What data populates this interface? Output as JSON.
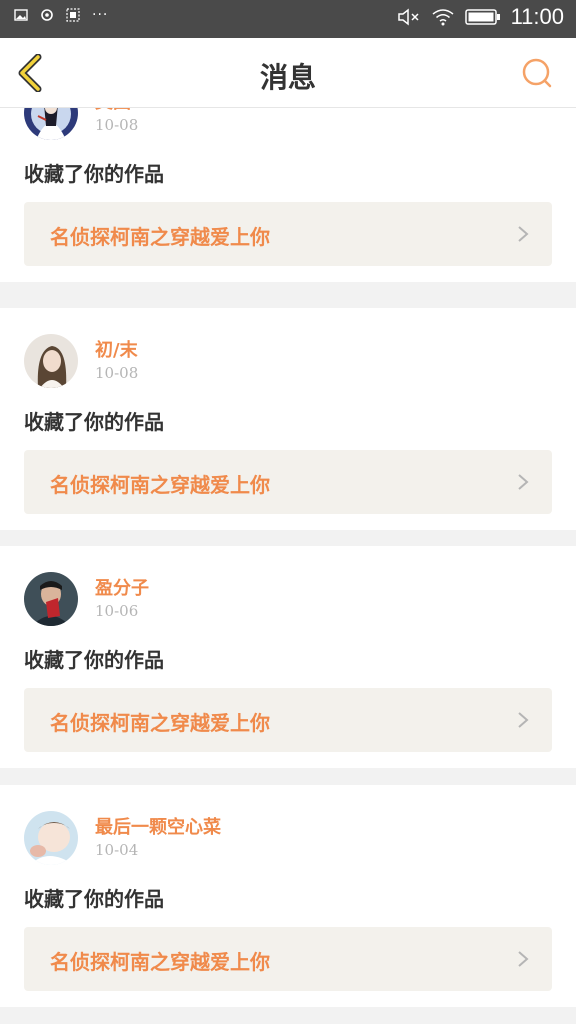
{
  "status_bar": {
    "time": "11:00",
    "dots": "···",
    "icons": [
      "image-icon",
      "sync-icon",
      "screenshot-icon",
      "mute-icon",
      "wifi-icon",
      "battery-icon"
    ]
  },
  "header": {
    "title": "消息",
    "back_icon": "chevron-left-icon",
    "search_icon": "search-icon",
    "accent_color": "#f08a4b"
  },
  "messages": [
    {
      "username": "美国",
      "date": "10-08",
      "action": "收藏了你的作品",
      "work_title": "名侦探柯南之穿越爱上你"
    },
    {
      "username": "初/末",
      "date": "10-08",
      "action": "收藏了你的作品",
      "work_title": "名侦探柯南之穿越爱上你"
    },
    {
      "username": "盈分子",
      "date": "10-06",
      "action": "收藏了你的作品",
      "work_title": "名侦探柯南之穿越爱上你"
    },
    {
      "username": "最后一颗空心菜",
      "date": "10-04",
      "action": "收藏了你的作品",
      "work_title": "名侦探柯南之穿越爱上你"
    }
  ]
}
